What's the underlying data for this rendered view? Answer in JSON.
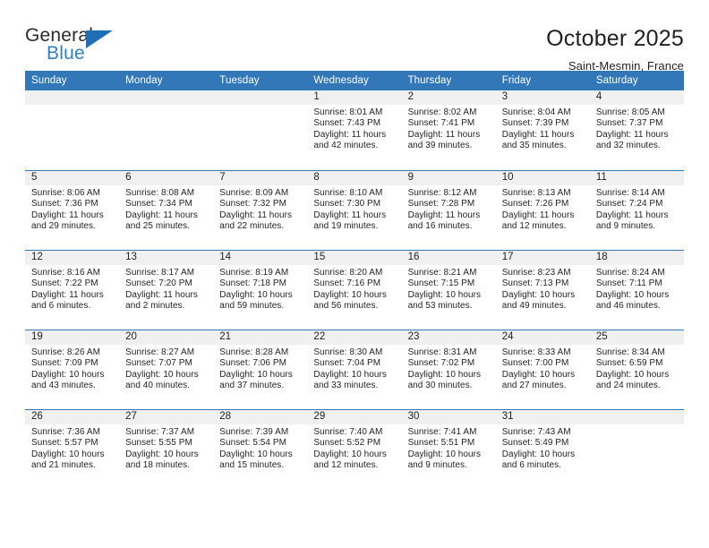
{
  "brand": {
    "name_top": "General",
    "name_bottom": "Blue",
    "accent_color": "#1f6fb5"
  },
  "header": {
    "title": "October 2025",
    "subtitle": "Saint-Mesmin, France"
  },
  "calendar": {
    "header_bg": "#3277b8",
    "day_band_bg": "#f0f0f0",
    "weekdays": [
      "Sunday",
      "Monday",
      "Tuesday",
      "Wednesday",
      "Thursday",
      "Friday",
      "Saturday"
    ],
    "weeks": [
      [
        {
          "day": "",
          "lines": []
        },
        {
          "day": "",
          "lines": []
        },
        {
          "day": "",
          "lines": []
        },
        {
          "day": "1",
          "lines": [
            "Sunrise: 8:01 AM",
            "Sunset: 7:43 PM",
            "Daylight: 11 hours",
            "and 42 minutes."
          ]
        },
        {
          "day": "2",
          "lines": [
            "Sunrise: 8:02 AM",
            "Sunset: 7:41 PM",
            "Daylight: 11 hours",
            "and 39 minutes."
          ]
        },
        {
          "day": "3",
          "lines": [
            "Sunrise: 8:04 AM",
            "Sunset: 7:39 PM",
            "Daylight: 11 hours",
            "and 35 minutes."
          ]
        },
        {
          "day": "4",
          "lines": [
            "Sunrise: 8:05 AM",
            "Sunset: 7:37 PM",
            "Daylight: 11 hours",
            "and 32 minutes."
          ]
        }
      ],
      [
        {
          "day": "5",
          "lines": [
            "Sunrise: 8:06 AM",
            "Sunset: 7:36 PM",
            "Daylight: 11 hours",
            "and 29 minutes."
          ]
        },
        {
          "day": "6",
          "lines": [
            "Sunrise: 8:08 AM",
            "Sunset: 7:34 PM",
            "Daylight: 11 hours",
            "and 25 minutes."
          ]
        },
        {
          "day": "7",
          "lines": [
            "Sunrise: 8:09 AM",
            "Sunset: 7:32 PM",
            "Daylight: 11 hours",
            "and 22 minutes."
          ]
        },
        {
          "day": "8",
          "lines": [
            "Sunrise: 8:10 AM",
            "Sunset: 7:30 PM",
            "Daylight: 11 hours",
            "and 19 minutes."
          ]
        },
        {
          "day": "9",
          "lines": [
            "Sunrise: 8:12 AM",
            "Sunset: 7:28 PM",
            "Daylight: 11 hours",
            "and 16 minutes."
          ]
        },
        {
          "day": "10",
          "lines": [
            "Sunrise: 8:13 AM",
            "Sunset: 7:26 PM",
            "Daylight: 11 hours",
            "and 12 minutes."
          ]
        },
        {
          "day": "11",
          "lines": [
            "Sunrise: 8:14 AM",
            "Sunset: 7:24 PM",
            "Daylight: 11 hours",
            "and 9 minutes."
          ]
        }
      ],
      [
        {
          "day": "12",
          "lines": [
            "Sunrise: 8:16 AM",
            "Sunset: 7:22 PM",
            "Daylight: 11 hours",
            "and 6 minutes."
          ]
        },
        {
          "day": "13",
          "lines": [
            "Sunrise: 8:17 AM",
            "Sunset: 7:20 PM",
            "Daylight: 11 hours",
            "and 2 minutes."
          ]
        },
        {
          "day": "14",
          "lines": [
            "Sunrise: 8:19 AM",
            "Sunset: 7:18 PM",
            "Daylight: 10 hours",
            "and 59 minutes."
          ]
        },
        {
          "day": "15",
          "lines": [
            "Sunrise: 8:20 AM",
            "Sunset: 7:16 PM",
            "Daylight: 10 hours",
            "and 56 minutes."
          ]
        },
        {
          "day": "16",
          "lines": [
            "Sunrise: 8:21 AM",
            "Sunset: 7:15 PM",
            "Daylight: 10 hours",
            "and 53 minutes."
          ]
        },
        {
          "day": "17",
          "lines": [
            "Sunrise: 8:23 AM",
            "Sunset: 7:13 PM",
            "Daylight: 10 hours",
            "and 49 minutes."
          ]
        },
        {
          "day": "18",
          "lines": [
            "Sunrise: 8:24 AM",
            "Sunset: 7:11 PM",
            "Daylight: 10 hours",
            "and 46 minutes."
          ]
        }
      ],
      [
        {
          "day": "19",
          "lines": [
            "Sunrise: 8:26 AM",
            "Sunset: 7:09 PM",
            "Daylight: 10 hours",
            "and 43 minutes."
          ]
        },
        {
          "day": "20",
          "lines": [
            "Sunrise: 8:27 AM",
            "Sunset: 7:07 PM",
            "Daylight: 10 hours",
            "and 40 minutes."
          ]
        },
        {
          "day": "21",
          "lines": [
            "Sunrise: 8:28 AM",
            "Sunset: 7:06 PM",
            "Daylight: 10 hours",
            "and 37 minutes."
          ]
        },
        {
          "day": "22",
          "lines": [
            "Sunrise: 8:30 AM",
            "Sunset: 7:04 PM",
            "Daylight: 10 hours",
            "and 33 minutes."
          ]
        },
        {
          "day": "23",
          "lines": [
            "Sunrise: 8:31 AM",
            "Sunset: 7:02 PM",
            "Daylight: 10 hours",
            "and 30 minutes."
          ]
        },
        {
          "day": "24",
          "lines": [
            "Sunrise: 8:33 AM",
            "Sunset: 7:00 PM",
            "Daylight: 10 hours",
            "and 27 minutes."
          ]
        },
        {
          "day": "25",
          "lines": [
            "Sunrise: 8:34 AM",
            "Sunset: 6:59 PM",
            "Daylight: 10 hours",
            "and 24 minutes."
          ]
        }
      ],
      [
        {
          "day": "26",
          "lines": [
            "Sunrise: 7:36 AM",
            "Sunset: 5:57 PM",
            "Daylight: 10 hours",
            "and 21 minutes."
          ]
        },
        {
          "day": "27",
          "lines": [
            "Sunrise: 7:37 AM",
            "Sunset: 5:55 PM",
            "Daylight: 10 hours",
            "and 18 minutes."
          ]
        },
        {
          "day": "28",
          "lines": [
            "Sunrise: 7:39 AM",
            "Sunset: 5:54 PM",
            "Daylight: 10 hours",
            "and 15 minutes."
          ]
        },
        {
          "day": "29",
          "lines": [
            "Sunrise: 7:40 AM",
            "Sunset: 5:52 PM",
            "Daylight: 10 hours",
            "and 12 minutes."
          ]
        },
        {
          "day": "30",
          "lines": [
            "Sunrise: 7:41 AM",
            "Sunset: 5:51 PM",
            "Daylight: 10 hours",
            "and 9 minutes."
          ]
        },
        {
          "day": "31",
          "lines": [
            "Sunrise: 7:43 AM",
            "Sunset: 5:49 PM",
            "Daylight: 10 hours",
            "and 6 minutes."
          ]
        },
        {
          "day": "",
          "lines": []
        }
      ]
    ]
  }
}
